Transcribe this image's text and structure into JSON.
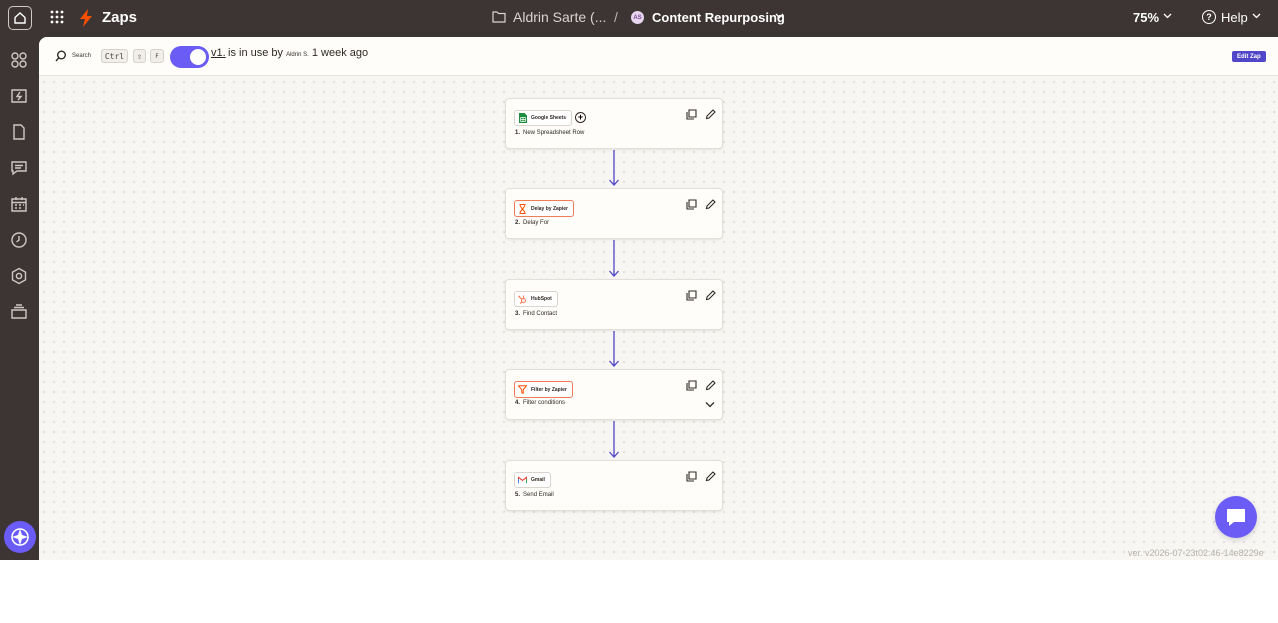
{
  "topbar": {
    "app_name": "Zaps",
    "folder_name": "Aldrin Sarte (...",
    "separator": "/",
    "owner_initials": "AS",
    "zap_name": "Content Repurposing",
    "zoom": "75%",
    "help_label": "Help"
  },
  "toolbar": {
    "search_label": "Search",
    "shortcut_keys": [
      "Ctrl",
      "⇧",
      "F"
    ],
    "toggle_on": true,
    "version_link": "v1.",
    "version_text_prefix": "is in use by",
    "version_user": "Aldrin S.",
    "version_time": "1 week ago",
    "edit_label": "Edit Zap"
  },
  "sidebar": {
    "icons": [
      "apps-icon",
      "zap-history-icon",
      "document-icon",
      "chat-icon",
      "calendar-icon",
      "clock-icon",
      "settings-icon",
      "layers-icon"
    ],
    "assistant_icon": "copilot-icon"
  },
  "steps": [
    {
      "number": "1.",
      "app": "Google Sheets",
      "title": "New Spreadsheet Row",
      "icon": "google-sheets-icon",
      "accent": "#1e8e3e",
      "highlight": false,
      "has_add": true,
      "has_chevron": false
    },
    {
      "number": "2.",
      "app": "Delay by Zapier",
      "title": "Delay For",
      "icon": "hourglass-icon",
      "accent": "#ff4f00",
      "highlight": true,
      "has_add": false,
      "has_chevron": false
    },
    {
      "number": "3.",
      "app": "HubSpot",
      "title": "Find Contact",
      "icon": "hubspot-icon",
      "accent": "#ff7a59",
      "highlight": false,
      "has_add": false,
      "has_chevron": false
    },
    {
      "number": "4.",
      "app": "Filter by Zapier",
      "title": "Filter conditions",
      "icon": "filter-icon",
      "accent": "#ff4f00",
      "highlight": true,
      "has_add": false,
      "has_chevron": true
    },
    {
      "number": "5.",
      "app": "Gmail",
      "title": "Send Email",
      "icon": "gmail-icon",
      "accent": "#ea4335",
      "highlight": false,
      "has_add": false,
      "has_chevron": false
    }
  ],
  "colors": {
    "accent": "#6a5cf5",
    "edit_button": "#5046c8",
    "chrome": "#3d3533"
  },
  "build_version": "ver. v2026-07-23t02:46-14e8229e"
}
